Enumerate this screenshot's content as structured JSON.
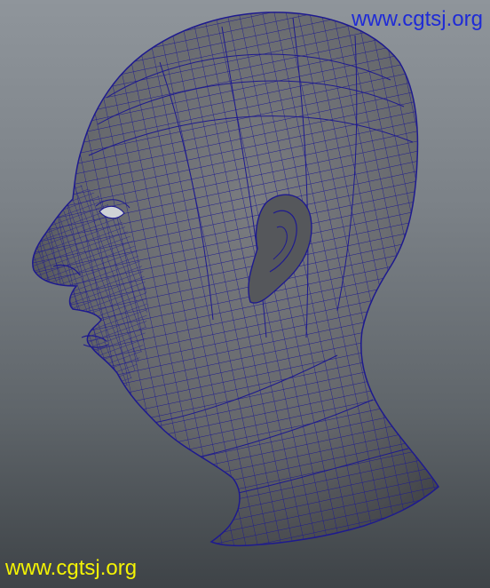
{
  "scene": {
    "subject": "head-mesh-side-view",
    "mesh_color": "#1e1a8f",
    "surface_color": "#6f7175",
    "background_top": "#8f959b",
    "background_bottom": "#3e4347"
  },
  "watermarks": {
    "top": {
      "text": "www.cgtsj.org",
      "color": "#1f2bd6"
    },
    "bottom": {
      "text": "www.cgtsj.org",
      "color": "#f3f304"
    }
  }
}
